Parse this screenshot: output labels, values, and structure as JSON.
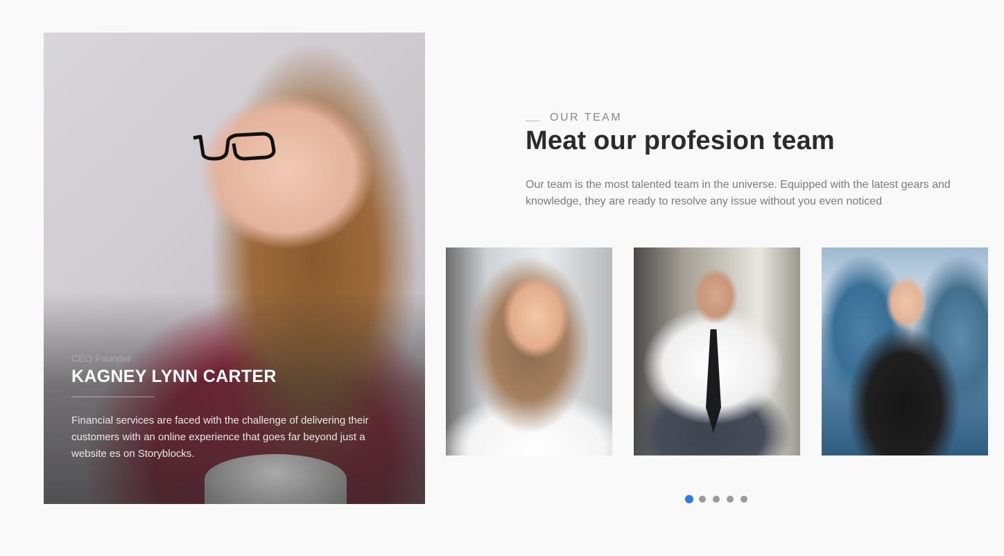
{
  "featured": {
    "role": "CEO Founder",
    "name": "KAGNEY LYNN CARTER",
    "bio": "Financial services are faced with the challenge of delivering their customers with an online experience that goes far beyond just a website es on Storyblocks."
  },
  "section": {
    "eyebrow": "OUR TEAM",
    "title": "Meat our profesion team",
    "description": "Our team is the most talented team in the universe. Equipped with the latest gears and knowledge, they are ready to resolve any issue without you even noticed"
  },
  "carousel": {
    "slide_count": 5,
    "active_slide": 1
  },
  "colors": {
    "accent": "#2f7bea",
    "heading": "#2b2b2b",
    "body_text": "#7b7b7b",
    "background": "#f9f9f9"
  }
}
